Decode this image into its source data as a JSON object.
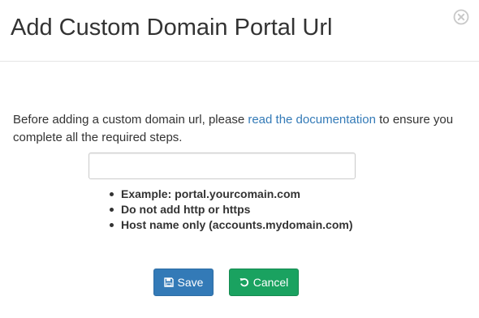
{
  "dialog": {
    "title": "Add Custom Domain Portal Url"
  },
  "intro": {
    "before_link": "Before adding a custom domain url, please ",
    "link_text": "read the documentation",
    "after_link": " to ensure you complete all the required steps."
  },
  "url_input": {
    "value": "",
    "placeholder": ""
  },
  "hints": [
    "Example: portal.yourcomain.com",
    "Do not add http or https",
    "Host name only (accounts.mydomain.com)"
  ],
  "buttons": {
    "save_label": "Save",
    "save_icon": "floppy-disk-icon",
    "cancel_label": "Cancel",
    "cancel_icon": "undo-icon"
  },
  "colors": {
    "link": "#337ab7",
    "save_button": "#337ab7",
    "cancel_button": "#1aa260"
  }
}
